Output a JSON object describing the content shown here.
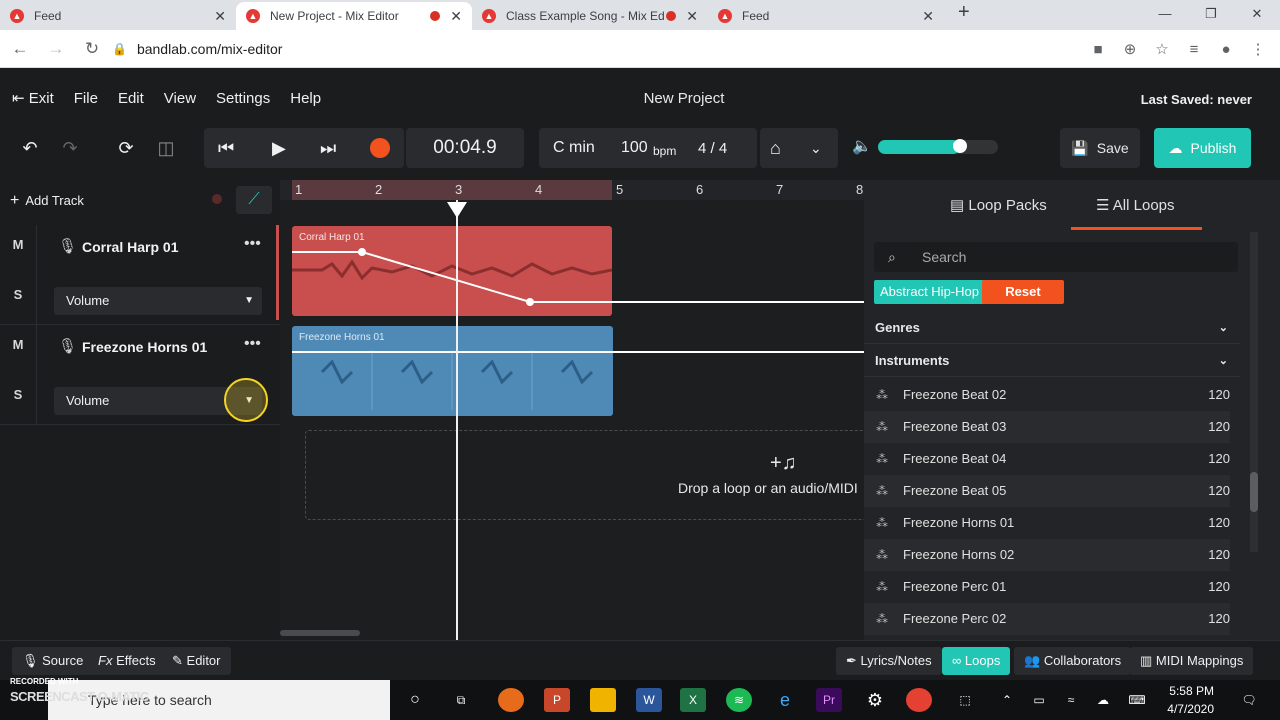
{
  "browser": {
    "tabs": [
      {
        "title": "Feed"
      },
      {
        "title": "New Project - Mix Editor",
        "recording": true
      },
      {
        "title": "Class Example Song - Mix Ed"
      },
      {
        "title": "Feed"
      }
    ],
    "url": "bandlab.com/mix-editor"
  },
  "menu": {
    "exit": "Exit",
    "items": [
      "File",
      "Edit",
      "View",
      "Settings",
      "Help"
    ],
    "project_title": "New Project",
    "last_saved": "Last Saved: never"
  },
  "transport": {
    "time": "00:04.9",
    "key": "C min",
    "bpm_value": "100",
    "bpm_unit": "bpm",
    "signature": "4 / 4",
    "volume_level": 0.68,
    "save": "Save",
    "publish": "Publish"
  },
  "tracks": {
    "add_track": "Add Track",
    "mute": "M",
    "solo": "S",
    "list": [
      {
        "name": "Corral Harp 01",
        "param": "Volume",
        "clip": "Corral Harp 01",
        "color": "#c94e4e"
      },
      {
        "name": "Freezone Horns 01",
        "param": "Volume",
        "clip": "Freezone Horns 01",
        "color": "#4f8ab7"
      }
    ]
  },
  "timeline": {
    "bars": [
      "1",
      "2",
      "3",
      "4",
      "5",
      "6",
      "7",
      "8"
    ],
    "drop_text": "Drop a loop or an audio/MIDI"
  },
  "loops": {
    "tab_packs": "Loop Packs",
    "tab_all": "All Loops",
    "search_placeholder": "Search",
    "chip_genre": "Abstract Hip-Hop",
    "chip_reset": "Reset",
    "genres": "Genres",
    "instruments": "Instruments",
    "items": [
      {
        "name": "Freezone Beat 02",
        "bpm": "120"
      },
      {
        "name": "Freezone Beat 03",
        "bpm": "120"
      },
      {
        "name": "Freezone Beat 04",
        "bpm": "120"
      },
      {
        "name": "Freezone Beat 05",
        "bpm": "120"
      },
      {
        "name": "Freezone Horns 01",
        "bpm": "120"
      },
      {
        "name": "Freezone Horns 02",
        "bpm": "120"
      },
      {
        "name": "Freezone Perc 01",
        "bpm": "120"
      },
      {
        "name": "Freezone Perc 02",
        "bpm": "120"
      }
    ]
  },
  "bottom": {
    "source": "Source",
    "effects": "Effects",
    "editor": "Editor",
    "lyrics": "Lyrics/Notes",
    "loops": "Loops",
    "collaborators": "Collaborators",
    "midi": "MIDI Mappings"
  },
  "taskbar": {
    "search": "Type here to search",
    "time": "5:58 PM",
    "date": "4/7/2020",
    "watermark_top": "RECORDED WITH",
    "watermark": "SCREENCAST-O-MATIC"
  },
  "colors": {
    "accent": "#21c6b4",
    "record": "#f2521e",
    "reset": "#f2521e"
  }
}
